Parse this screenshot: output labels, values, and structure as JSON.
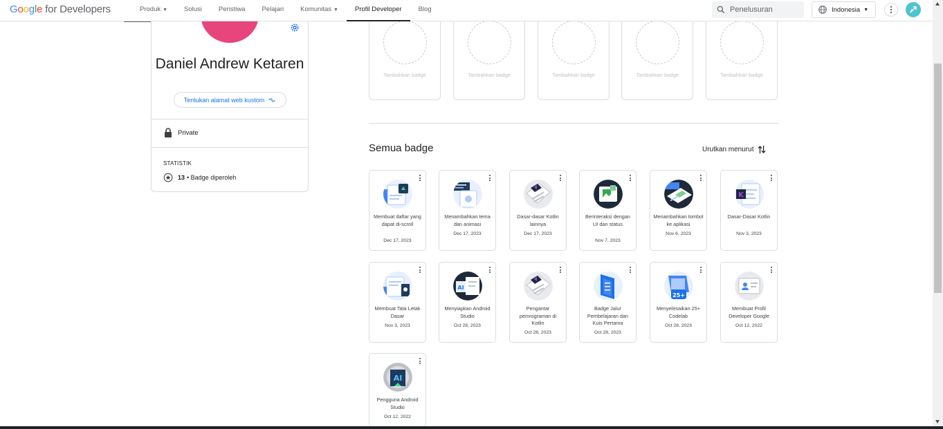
{
  "header": {
    "logo_google": [
      "G",
      "o",
      "o",
      "g",
      "l",
      "e"
    ],
    "logo_rest": "for Developers",
    "tabs": [
      {
        "label": "Produk",
        "has_menu": true
      },
      {
        "label": "Solusi",
        "has_menu": false
      },
      {
        "label": "Peristiwa",
        "has_menu": false
      },
      {
        "label": "Pelajari",
        "has_menu": false
      },
      {
        "label": "Komunitas",
        "has_menu": true
      },
      {
        "label": "Profil Developer",
        "has_menu": false,
        "active": true
      },
      {
        "label": "Blog",
        "has_menu": false
      }
    ],
    "search_placeholder": "Penelusuran",
    "language": "Indonesia"
  },
  "profile": {
    "name": "Daniel Andrew Ketaren",
    "custom_url_label": "Tentukan alamat web kustom",
    "visibility": "Private",
    "stats_title": "STATISTIK",
    "badge_count": "13",
    "badge_count_label": "• Badge diperoleh"
  },
  "featured": {
    "slot_label": "Tambahkan badge",
    "slots": 5
  },
  "all_badges": {
    "title": "Semua badge",
    "sort_label": "Urutkan menurut",
    "items": [
      {
        "title": "Membuat daftar yang dapat di-scroll",
        "date": "Dec 17, 2023",
        "icon": "scroll-list-badge-icon"
      },
      {
        "title": "Menambahkan tema dan animasi",
        "date": "Dec 17, 2023",
        "icon": "theme-animation-badge-icon"
      },
      {
        "title": "Dasar-dasar Kotlin lainnya",
        "date": "Dec 17, 2023",
        "icon": "kotlin-more-basics-badge-icon"
      },
      {
        "title": "Berinteraksi dengan UI dan status",
        "date": "Nov 7, 2023",
        "icon": "ui-state-badge-icon"
      },
      {
        "title": "Menambahkan tombol ke aplikasi",
        "date": "Nov 6, 2023",
        "icon": "add-button-badge-icon"
      },
      {
        "title": "Dasar-Dasar Kotlin",
        "date": "Nov 3, 2023",
        "icon": "kotlin-basics-badge-icon"
      },
      {
        "title": "Membuat Tata Letak Dasar",
        "date": "Nov 3, 2023",
        "icon": "basic-layout-badge-icon"
      },
      {
        "title": "Menyiapkan Android Studio",
        "date": "Oct 28, 2023",
        "icon": "setup-android-studio-badge-icon"
      },
      {
        "title": "Pengantar pemrograman di Kotlin",
        "date": "Oct 28, 2023",
        "icon": "intro-kotlin-badge-icon"
      },
      {
        "title": "Badge Jalur Pembelajaran dan Kuis Pertama",
        "date": "Oct 28, 2023",
        "icon": "learning-path-badge-icon"
      },
      {
        "title": "Menyelesaikan 25+ Codelab",
        "date": "Oct 28, 2023",
        "icon": "codelab-25-badge-icon"
      },
      {
        "title": "Membuat Profil Developer Google",
        "date": "Oct 12, 2022",
        "icon": "developer-profile-badge-icon"
      },
      {
        "title": "Pengguna Android Studio",
        "date": "Oct 12, 2022",
        "icon": "android-studio-user-badge-icon"
      }
    ]
  },
  "icons_text": {
    "codelab_count": "25+",
    "kotlin_mark": "K",
    "ai_mark": "AI"
  },
  "colors": {
    "accent_blue": "#1a73e8",
    "avatar_pink": "#e8457c",
    "user_avatar": "#4fc3cf"
  }
}
